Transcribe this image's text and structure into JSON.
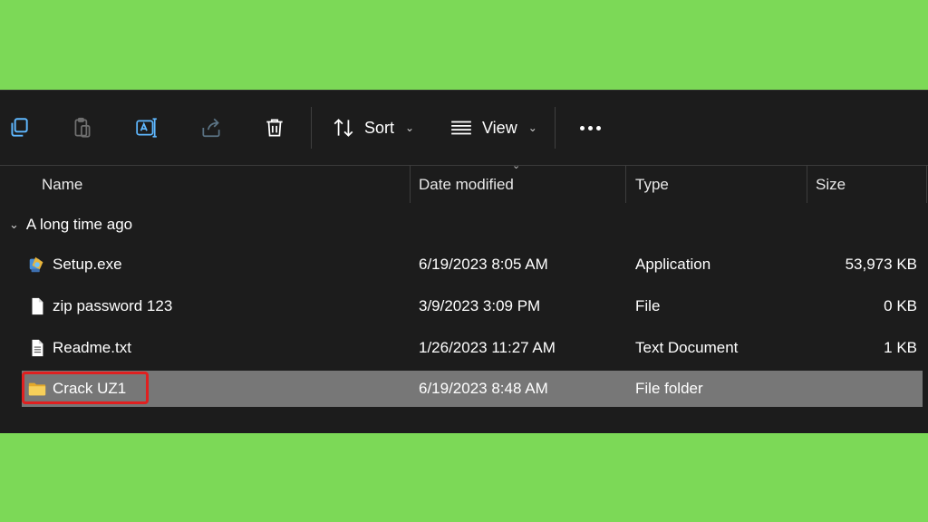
{
  "toolbar": {
    "sort_label": "Sort",
    "view_label": "View",
    "icons": [
      "copy-icon",
      "paste-icon",
      "rename-icon",
      "share-icon",
      "delete-icon",
      "sort-icon",
      "view-icon",
      "more-icon"
    ]
  },
  "columns": {
    "name": "Name",
    "date": "Date modified",
    "type": "Type",
    "size": "Size"
  },
  "group": {
    "label": "A long time ago"
  },
  "files": [
    {
      "name": "Setup.exe",
      "date": "6/19/2023 8:05 AM",
      "type": "Application",
      "size": "53,973 KB",
      "icon": "application-icon"
    },
    {
      "name": "zip password 123",
      "date": "3/9/2023 3:09 PM",
      "type": "File",
      "size": "0 KB",
      "icon": "file-icon"
    },
    {
      "name": "Readme.txt",
      "date": "1/26/2023 11:27 AM",
      "type": "Text Document",
      "size": "1 KB",
      "icon": "text-document-icon"
    },
    {
      "name": "Crack UZ1",
      "date": "6/19/2023 8:48 AM",
      "type": "File folder",
      "size": "",
      "icon": "folder-icon"
    }
  ],
  "colors": {
    "background": "#7cd957",
    "window": "#1c1c1c",
    "selected_row": "#777777",
    "highlight": "#e02020"
  }
}
